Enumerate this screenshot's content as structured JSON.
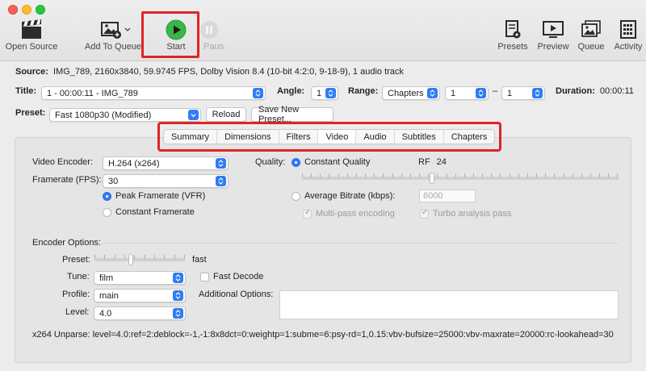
{
  "toolbar": {
    "open_source": "Open Source",
    "add_to_queue": "Add To Queue",
    "start": "Start",
    "pause": "Pause",
    "presets": "Presets",
    "preview": "Preview",
    "queue": "Queue",
    "activity": "Activity"
  },
  "source": {
    "label": "Source:",
    "value": "IMG_789, 2160x3840, 59.9745 FPS, Dolby Vision 8.4 (10-bit 4:2:0, 9-18-9), 1 audio track"
  },
  "title_row": {
    "title_label": "Title:",
    "title_value": "1 - 00:00:11 - IMG_789",
    "angle_label": "Angle:",
    "angle_value": "1",
    "range_label": "Range:",
    "range_value": "Chapters",
    "range_from": "1",
    "range_dash": "–",
    "range_to": "1",
    "duration_label": "Duration:",
    "duration_value": "00:00:11"
  },
  "preset_row": {
    "label": "Preset:",
    "value": "Fast 1080p30 (Modified)",
    "reload": "Reload",
    "save_new": "Save New Preset..."
  },
  "tabs": [
    {
      "label": "Summary",
      "active": false
    },
    {
      "label": "Dimensions",
      "active": false
    },
    {
      "label": "Filters",
      "active": false
    },
    {
      "label": "Video",
      "active": true
    },
    {
      "label": "Audio",
      "active": false
    },
    {
      "label": "Subtitles",
      "active": false
    },
    {
      "label": "Chapters",
      "active": false
    }
  ],
  "video": {
    "encoder_label": "Video Encoder:",
    "encoder_value": "H.264 (x264)",
    "framerate_label": "Framerate (FPS):",
    "framerate_value": "30",
    "peak_framerate": "Peak Framerate (VFR)",
    "constant_framerate": "Constant Framerate",
    "quality_label": "Quality:",
    "constant_quality": "Constant Quality",
    "rf_label": "RF",
    "rf_value": "24",
    "quality_slider_fraction": 0.41,
    "average_bitrate": "Average Bitrate (kbps):",
    "bitrate_value": "6000",
    "multipass": "Multi-pass encoding",
    "turbo": "Turbo analysis pass"
  },
  "encoder_options": {
    "heading": "Encoder Options:",
    "preset_label": "Preset:",
    "preset_value": "fast",
    "preset_slider_fraction": 0.4,
    "tune_label": "Tune:",
    "tune_value": "film",
    "fast_decode": "Fast Decode",
    "profile_label": "Profile:",
    "profile_value": "main",
    "additional_label": "Additional Options:",
    "level_label": "Level:",
    "level_value": "4.0"
  },
  "unparse": "x264 Unparse: level=4.0:ref=2:deblock=-1,-1:8x8dct=0:weightp=1:subme=6:psy-rd=1,0.15:vbv-bufsize=25000:vbv-maxrate=20000:rc-lookahead=30",
  "colors": {
    "accent": "#2f7cf6",
    "highlight": "#e02424",
    "start_green": "#3bb54a"
  }
}
